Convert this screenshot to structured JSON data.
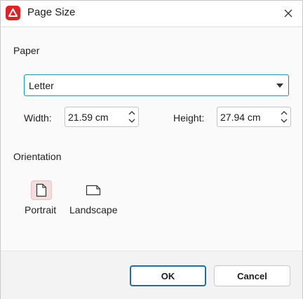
{
  "window": {
    "title": "Page Size",
    "close_icon": "close-icon",
    "app_icon": "app-logo-icon",
    "accent": "#d9262b"
  },
  "paper": {
    "section_label": "Paper",
    "selected": "Letter",
    "width_label": "Width:",
    "width_value": "21.59 cm",
    "height_label": "Height:",
    "height_value": "27.94 cm"
  },
  "orientation": {
    "section_label": "Orientation",
    "options": [
      {
        "label": "Portrait",
        "selected": true,
        "icon": "portrait-page-icon"
      },
      {
        "label": "Landscape",
        "selected": false,
        "icon": "landscape-page-icon"
      }
    ]
  },
  "buttons": {
    "ok": "OK",
    "cancel": "Cancel"
  }
}
